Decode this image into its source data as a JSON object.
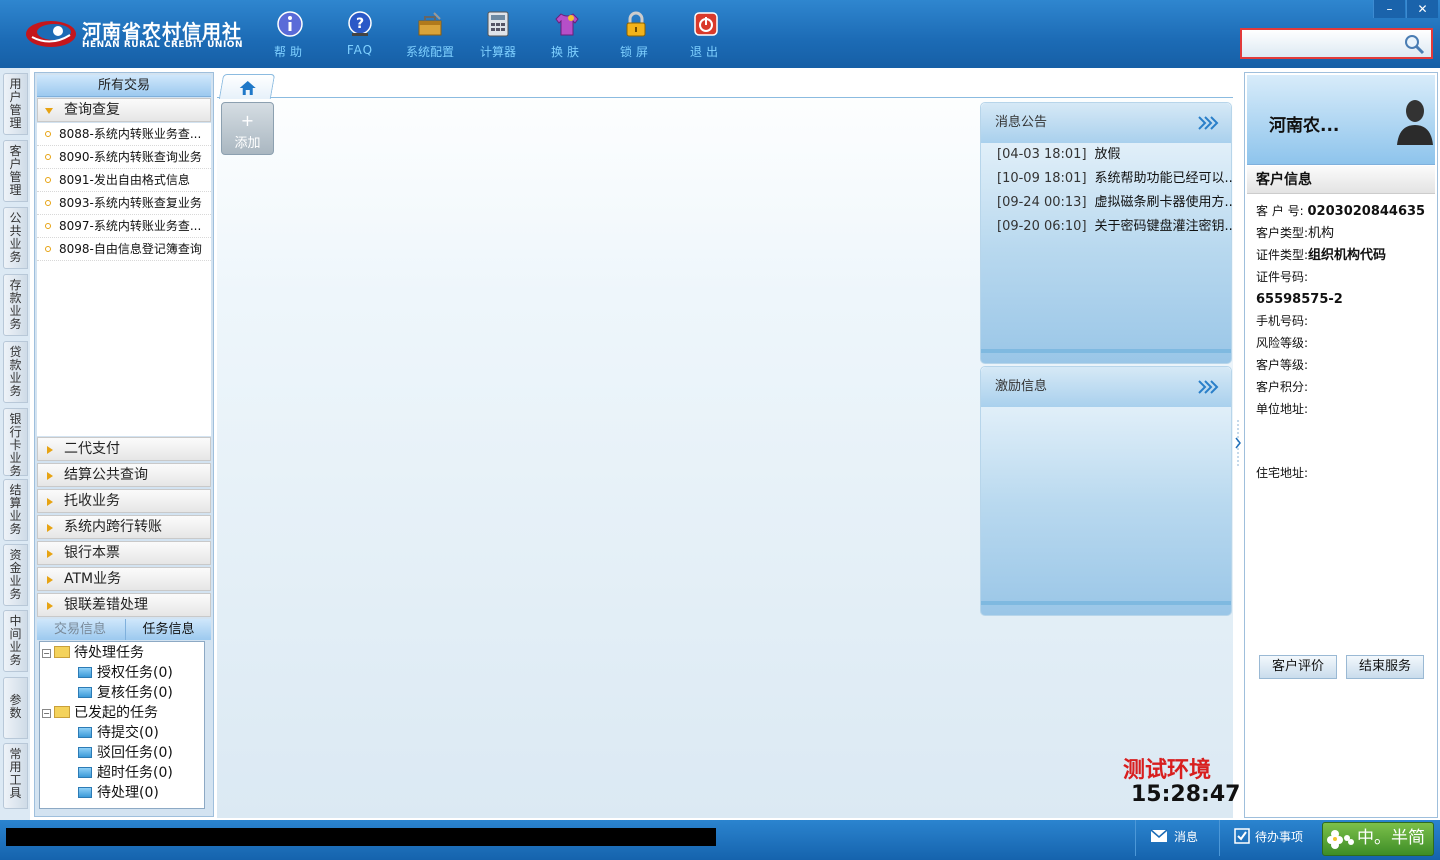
{
  "header": {
    "logo_cn": "河南省农村信用社",
    "logo_en": "HENAN RURAL CREDIT UNION",
    "tools": [
      {
        "label": "帮助",
        "icon": "info-icon"
      },
      {
        "label": "FAQ",
        "icon": "help-icon"
      },
      {
        "label": "系统配置",
        "icon": "toolbox-icon"
      },
      {
        "label": "计算器",
        "icon": "calculator-icon"
      },
      {
        "label": "换肤",
        "icon": "shirt-icon"
      },
      {
        "label": "锁屏",
        "icon": "lock-icon"
      },
      {
        "label": "退出",
        "icon": "power-icon"
      }
    ],
    "search_value": "",
    "win_min": "–",
    "win_close": "✕"
  },
  "vtabs": [
    "用户管理",
    "客户管理",
    "公共业务",
    "存款业务",
    "贷款业务",
    "银行卡业务",
    "结算业务",
    "资金业务",
    "中间业务",
    "参数",
    "常用工具"
  ],
  "left": {
    "title": "所有交易",
    "open_group": "查询查复",
    "submenu": [
      "8088-系统内转账业务查...",
      "8090-系统内转账查询业务",
      "8091-发出自由格式信息",
      "8093-系统内转账查复业务",
      "8097-系统内转账业务查...",
      "8098-自由信息登记簿查询"
    ],
    "groups": [
      "二代支付",
      "结算公共查询",
      "托收业务",
      "系统内跨行转账",
      "银行本票",
      "ATM业务",
      "银联差错处理"
    ],
    "info_tabs": [
      "交易信息",
      "任务信息"
    ],
    "tree": {
      "pending": "待处理任务",
      "auth": "授权任务(0)",
      "review": "复核任务(0)",
      "started": "已发起的任务",
      "to_submit": "待提交(0)",
      "rejected": "驳回任务(0)",
      "timeout": "超时任务(0)",
      "to_process": "待处理(0)",
      "expander": "−"
    }
  },
  "main": {
    "add_plus": "+",
    "add_label": "添加",
    "notice_title": "消息公告",
    "notices": [
      {
        "date": "[04-03 18:01]",
        "text": "放假"
      },
      {
        "date": "[10-09 18:01]",
        "text": "系统帮助功能已经可以..."
      },
      {
        "date": "[09-24 00:13]",
        "text": "虚拟磁条刷卡器使用方..."
      },
      {
        "date": "[09-20 06:10]",
        "text": "关于密码键盘灌注密钥..."
      }
    ],
    "incentive_title": "激励信息",
    "env_label": "测试环境",
    "clock": "15:28:47"
  },
  "right": {
    "name": "河南农...",
    "section": "客户信息",
    "cust_no_label": "客 户 号:",
    "cust_no": "0203020844635",
    "cust_type_label": "客户类型:",
    "cust_type": "机构",
    "id_type_label": "证件类型:",
    "id_type": "组织机构代码",
    "id_no_label": "证件号码:",
    "id_no": "65598575-2",
    "phone_label": "手机号码:",
    "risk_label": "风险等级:",
    "level_label": "客户等级:",
    "points_label": "客户积分:",
    "work_addr_label": "单位地址:",
    "home_addr_label": "住宅地址:",
    "eval_btn": "客户评价",
    "end_btn": "结束服务"
  },
  "status": {
    "messages": "消息",
    "todo": "待办事项",
    "ime": "中。半简"
  }
}
